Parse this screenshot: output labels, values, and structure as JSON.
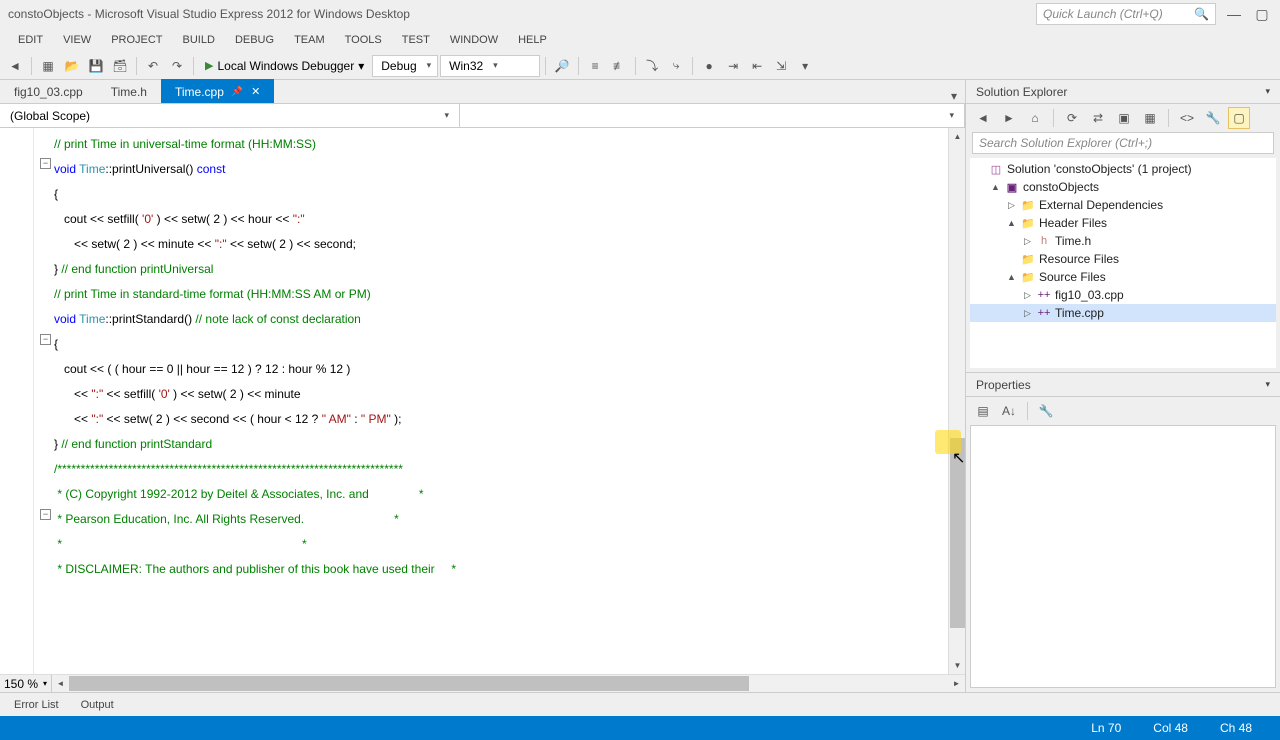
{
  "title": "constoObjects - Microsoft Visual Studio Express 2012 for Windows Desktop",
  "quick_launch_placeholder": "Quick Launch (Ctrl+Q)",
  "menu": [
    "EDIT",
    "VIEW",
    "PROJECT",
    "BUILD",
    "DEBUG",
    "TEAM",
    "TOOLS",
    "TEST",
    "WINDOW",
    "HELP"
  ],
  "toolbar": {
    "debugger_label": "Local Windows Debugger",
    "config": "Debug",
    "platform": "Win32"
  },
  "tabs": [
    {
      "label": "fig10_03.cpp",
      "active": false
    },
    {
      "label": "Time.h",
      "active": false
    },
    {
      "label": "Time.cpp",
      "active": true
    }
  ],
  "scope": {
    "left": "(Global Scope)",
    "right": ""
  },
  "zoom": "150 %",
  "code_lines": [
    [
      [
        "c-comment",
        "// print Time in universal-time format (HH:MM:SS)"
      ]
    ],
    [
      [
        "c-keyword",
        "void"
      ],
      [
        "",
        " "
      ],
      [
        "c-type",
        "Time"
      ],
      [
        "",
        "::printUniversal() "
      ],
      [
        "c-keyword",
        "const"
      ]
    ],
    [
      [
        "",
        "{"
      ]
    ],
    [
      [
        "",
        "   cout << setfill( "
      ],
      [
        "c-string",
        "'0'"
      ],
      [
        "",
        " ) << setw( 2 ) << hour << "
      ],
      [
        "c-string",
        "\":\""
      ]
    ],
    [
      [
        "",
        "      << setw( 2 ) << minute << "
      ],
      [
        "c-string",
        "\":\""
      ],
      [
        "",
        " << setw( 2 ) << second;"
      ]
    ],
    [
      [
        "",
        "} "
      ],
      [
        "c-comment",
        "// end function printUniversal"
      ]
    ],
    [
      [
        "",
        ""
      ]
    ],
    [
      [
        "c-comment",
        "// print Time in standard-time format (HH:MM:SS AM or PM)"
      ]
    ],
    [
      [
        "c-keyword",
        "void"
      ],
      [
        "",
        " "
      ],
      [
        "c-type",
        "Time"
      ],
      [
        "",
        "::printStandard() "
      ],
      [
        "c-comment",
        "// note lack of const declaration"
      ]
    ],
    [
      [
        "",
        "{"
      ]
    ],
    [
      [
        "",
        "   cout << ( ( hour == 0 || hour == 12 ) ? 12 : hour % 12 )"
      ]
    ],
    [
      [
        "",
        "      << "
      ],
      [
        "c-string",
        "\":\""
      ],
      [
        "",
        " << setfill( "
      ],
      [
        "c-string",
        "'0'"
      ],
      [
        "",
        " ) << setw( 2 ) << minute"
      ]
    ],
    [
      [
        "",
        "      << "
      ],
      [
        "c-string",
        "\":\""
      ],
      [
        "",
        " << setw( 2 ) << second << ( hour < 12 ? "
      ],
      [
        "c-string",
        "\" AM\""
      ],
      [
        "",
        " : "
      ],
      [
        "c-string",
        "\" PM\""
      ],
      [
        "",
        " );"
      ]
    ],
    [
      [
        "",
        "} "
      ],
      [
        "c-comment",
        "// end function printStandard"
      ]
    ],
    [
      [
        "",
        ""
      ]
    ],
    [
      [
        "c-comment",
        "/**************************************************************************"
      ]
    ],
    [
      [
        "c-comment",
        " * (C) Copyright 1992-2012 by Deitel & Associates, Inc. and               *"
      ]
    ],
    [
      [
        "c-comment",
        " * Pearson Education, Inc. All Rights Reserved.                           *"
      ]
    ],
    [
      [
        "c-comment",
        " *                                                                        *"
      ]
    ],
    [
      [
        "c-comment",
        " * DISCLAIMER: The authors and publisher of this book have used their     *"
      ]
    ]
  ],
  "solution_explorer": {
    "title": "Solution Explorer",
    "search_placeholder": "Search Solution Explorer (Ctrl+;)",
    "tree": [
      {
        "depth": 0,
        "exp": "",
        "icon": "sln",
        "label": "Solution 'constoObjects' (1 project)"
      },
      {
        "depth": 1,
        "exp": "▲",
        "icon": "proj",
        "label": "constoObjects"
      },
      {
        "depth": 2,
        "exp": "▷",
        "icon": "folder",
        "label": "External Dependencies"
      },
      {
        "depth": 2,
        "exp": "▲",
        "icon": "folder",
        "label": "Header Files"
      },
      {
        "depth": 3,
        "exp": "▷",
        "icon": "hfile",
        "label": "Time.h"
      },
      {
        "depth": 2,
        "exp": "",
        "icon": "folder",
        "label": "Resource Files"
      },
      {
        "depth": 2,
        "exp": "▲",
        "icon": "folder",
        "label": "Source Files"
      },
      {
        "depth": 3,
        "exp": "▷",
        "icon": "cfile",
        "label": "fig10_03.cpp"
      },
      {
        "depth": 3,
        "exp": "▷",
        "icon": "cfile",
        "label": "Time.cpp",
        "selected": true
      }
    ]
  },
  "properties": {
    "title": "Properties"
  },
  "bottom_tabs": [
    "Error List",
    "Output"
  ],
  "status": {
    "line": "Ln 70",
    "col": "Col 48",
    "ch": "Ch 48"
  }
}
